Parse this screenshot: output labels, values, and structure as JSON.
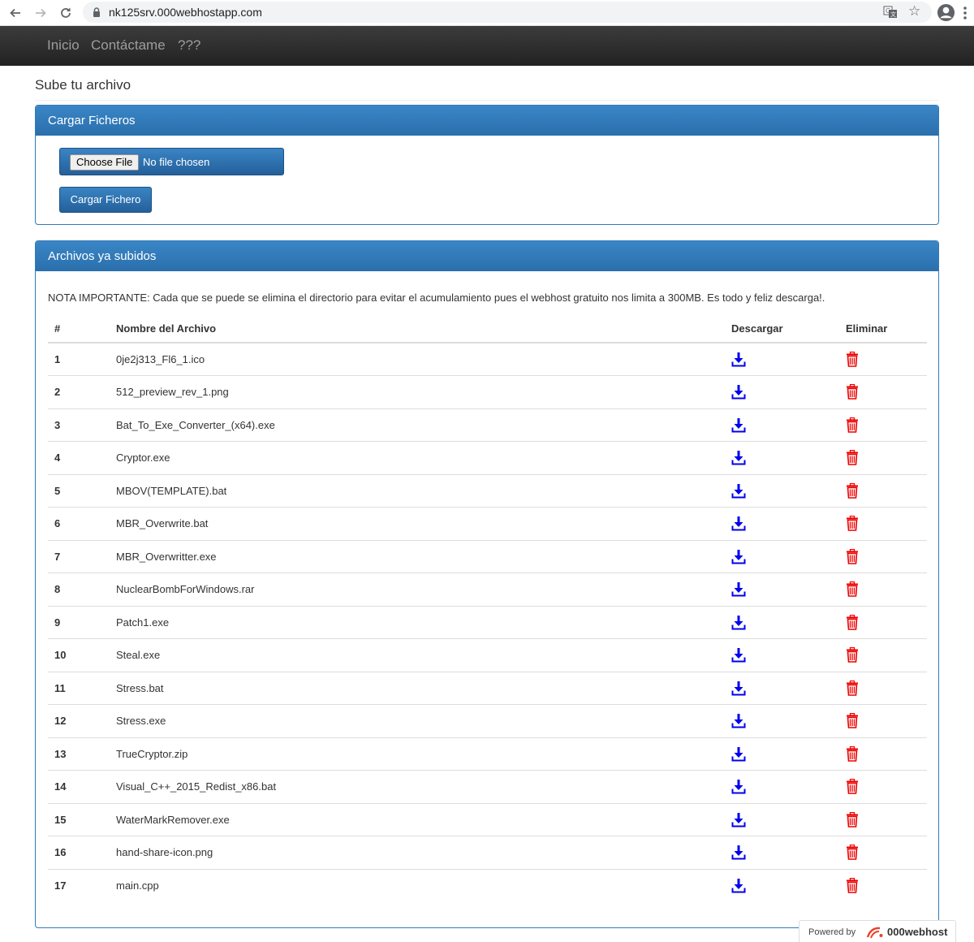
{
  "browser": {
    "url": "nk125srv.000webhostapp.com"
  },
  "navbar": {
    "items": [
      "Inicio",
      "Contáctame",
      "???"
    ]
  },
  "page": {
    "header": "Sube tu archivo"
  },
  "upload_panel": {
    "title": "Cargar Ficheros",
    "choose_label": "Choose File",
    "no_file_label": "No file chosen",
    "submit_label": "Cargar Fichero"
  },
  "files_panel": {
    "title": "Archivos ya subidos",
    "note": "NOTA IMPORTANTE: Cada que se puede se elimina el directorio para evitar el acumulamiento pues el webhost gratuito nos limita a 300MB. Es todo y feliz descarga!.",
    "columns": [
      "#",
      "Nombre del Archivo",
      "Descargar",
      "Eliminar"
    ],
    "rows": [
      {
        "num": "1",
        "name": "0je2j313_Fl6_1.ico"
      },
      {
        "num": "2",
        "name": "512_preview_rev_1.png"
      },
      {
        "num": "3",
        "name": "Bat_To_Exe_Converter_(x64).exe"
      },
      {
        "num": "4",
        "name": "Cryptor.exe"
      },
      {
        "num": "5",
        "name": "MBOV(TEMPLATE).bat"
      },
      {
        "num": "6",
        "name": "MBR_Overwrite.bat"
      },
      {
        "num": "7",
        "name": "MBR_Overwritter.exe"
      },
      {
        "num": "8",
        "name": "NuclearBombForWindows.rar"
      },
      {
        "num": "9",
        "name": "Patch1.exe"
      },
      {
        "num": "10",
        "name": "Steal.exe"
      },
      {
        "num": "11",
        "name": "Stress.bat"
      },
      {
        "num": "12",
        "name": "Stress.exe"
      },
      {
        "num": "13",
        "name": "TrueCryptor.zip"
      },
      {
        "num": "14",
        "name": "Visual_C++_2015_Redist_x86.bat"
      },
      {
        "num": "15",
        "name": "WaterMarkRemover.exe"
      },
      {
        "num": "16",
        "name": "hand-share-icon.png"
      },
      {
        "num": "17",
        "name": "main.cpp"
      }
    ],
    "download_icon": "download-icon",
    "delete_icon": "trash-icon"
  },
  "footer": {
    "powered_by": "Powered by",
    "brand": "000webhost"
  },
  "colors": {
    "navbar": "#222222",
    "panel_primary": "#337ab7",
    "download_icon": "#0000ee",
    "delete_icon": "#ee0000"
  }
}
